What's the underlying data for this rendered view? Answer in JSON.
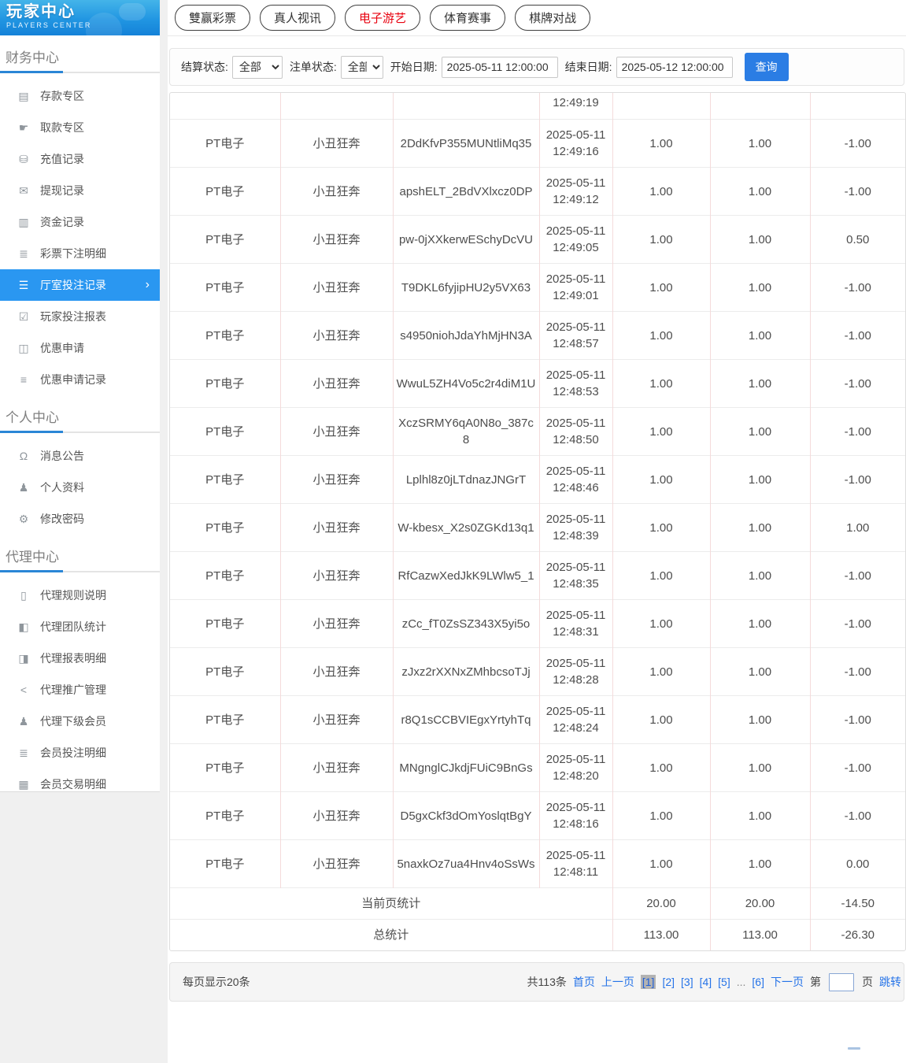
{
  "logo": {
    "title": "玩家中心",
    "subtitle": "PLAYERS CENTER"
  },
  "sidebar": {
    "sections": [
      {
        "title": "财务中心",
        "items": [
          {
            "label": "存款专区",
            "icon": "deposit-card-icon"
          },
          {
            "label": "取款专区",
            "icon": "withdraw-hand-icon"
          },
          {
            "label": "充值记录",
            "icon": "recharge-coins-icon"
          },
          {
            "label": "提现记录",
            "icon": "withdrawal-wallet-icon"
          },
          {
            "label": "资金记录",
            "icon": "funds-banknote-icon"
          },
          {
            "label": "彩票下注明细",
            "icon": "lottery-list-icon"
          },
          {
            "label": "厅室投注记录",
            "icon": "hall-records-icon",
            "active": true
          },
          {
            "label": "玩家投注报表",
            "icon": "player-report-icon"
          },
          {
            "label": "优惠申请",
            "icon": "promo-apply-icon"
          },
          {
            "label": "优惠申请记录",
            "icon": "promo-records-icon"
          }
        ]
      },
      {
        "title": "个人中心",
        "items": [
          {
            "label": "消息公告",
            "icon": "bell-icon"
          },
          {
            "label": "个人资料",
            "icon": "user-icon"
          },
          {
            "label": "修改密码",
            "icon": "gear-icon"
          }
        ]
      },
      {
        "title": "代理中心",
        "items": [
          {
            "label": "代理规则说明",
            "icon": "agent-rules-doc-icon"
          },
          {
            "label": "代理团队统计",
            "icon": "team-stats-icon"
          },
          {
            "label": "代理报表明细",
            "icon": "agent-report-icon"
          },
          {
            "label": "代理推广管理",
            "icon": "share-icon"
          },
          {
            "label": "代理下级会员",
            "icon": "members-icon"
          },
          {
            "label": "会员投注明细",
            "icon": "member-bets-icon"
          },
          {
            "label": "会员交易明细",
            "icon": "member-trades-icon"
          }
        ]
      }
    ]
  },
  "top_tabs": [
    {
      "label": "雙赢彩票",
      "active": false
    },
    {
      "label": "真人视讯",
      "active": false
    },
    {
      "label": "电子游艺",
      "active": true
    },
    {
      "label": "体育赛事",
      "active": false
    },
    {
      "label": "棋牌对战",
      "active": false
    }
  ],
  "filters": {
    "settle_label": "结算状态:",
    "settle_value": "全部",
    "order_label": "注单状态:",
    "order_value": "全部",
    "start_label": "开始日期:",
    "start_value": "2025-05-11 12:00:00",
    "end_label": "结束日期:",
    "end_value": "2025-05-12 12:00:00",
    "search_label": "查询"
  },
  "table": {
    "partial_row_time": "12:49:19",
    "rows": [
      {
        "provider": "PT电子",
        "game": "小丑狂奔",
        "order_id": "2DdKfvP355MUNtliMq35",
        "datetime": "2025-05-11 12:49:16",
        "bet": "1.00",
        "valid": "1.00",
        "profit": "-1.00"
      },
      {
        "provider": "PT电子",
        "game": "小丑狂奔",
        "order_id": "apshELT_2BdVXlxcz0DP",
        "datetime": "2025-05-11 12:49:12",
        "bet": "1.00",
        "valid": "1.00",
        "profit": "-1.00"
      },
      {
        "provider": "PT电子",
        "game": "小丑狂奔",
        "order_id": "pw-0jXXkerwESchyDcVU",
        "datetime": "2025-05-11 12:49:05",
        "bet": "1.00",
        "valid": "1.00",
        "profit": "0.50"
      },
      {
        "provider": "PT电子",
        "game": "小丑狂奔",
        "order_id": "T9DKL6fyjipHU2y5VX63",
        "datetime": "2025-05-11 12:49:01",
        "bet": "1.00",
        "valid": "1.00",
        "profit": "-1.00"
      },
      {
        "provider": "PT电子",
        "game": "小丑狂奔",
        "order_id": "s4950niohJdaYhMjHN3A",
        "datetime": "2025-05-11 12:48:57",
        "bet": "1.00",
        "valid": "1.00",
        "profit": "-1.00"
      },
      {
        "provider": "PT电子",
        "game": "小丑狂奔",
        "order_id": "WwuL5ZH4Vo5c2r4diM1U",
        "datetime": "2025-05-11 12:48:53",
        "bet": "1.00",
        "valid": "1.00",
        "profit": "-1.00"
      },
      {
        "provider": "PT电子",
        "game": "小丑狂奔",
        "order_id": "XczSRMY6qA0N8o_387c8",
        "datetime": "2025-05-11 12:48:50",
        "bet": "1.00",
        "valid": "1.00",
        "profit": "-1.00"
      },
      {
        "provider": "PT电子",
        "game": "小丑狂奔",
        "order_id": "Lplhl8z0jLTdnazJNGrT",
        "datetime": "2025-05-11 12:48:46",
        "bet": "1.00",
        "valid": "1.00",
        "profit": "-1.00"
      },
      {
        "provider": "PT电子",
        "game": "小丑狂奔",
        "order_id": "W-kbesx_X2s0ZGKd13q1",
        "datetime": "2025-05-11 12:48:39",
        "bet": "1.00",
        "valid": "1.00",
        "profit": "1.00"
      },
      {
        "provider": "PT电子",
        "game": "小丑狂奔",
        "order_id": "RfCazwXedJkK9LWlw5_1",
        "datetime": "2025-05-11 12:48:35",
        "bet": "1.00",
        "valid": "1.00",
        "profit": "-1.00"
      },
      {
        "provider": "PT电子",
        "game": "小丑狂奔",
        "order_id": "zCc_fT0ZsSZ343X5yi5o",
        "datetime": "2025-05-11 12:48:31",
        "bet": "1.00",
        "valid": "1.00",
        "profit": "-1.00"
      },
      {
        "provider": "PT电子",
        "game": "小丑狂奔",
        "order_id": "zJxz2rXXNxZMhbcsoTJj",
        "datetime": "2025-05-11 12:48:28",
        "bet": "1.00",
        "valid": "1.00",
        "profit": "-1.00"
      },
      {
        "provider": "PT电子",
        "game": "小丑狂奔",
        "order_id": "r8Q1sCCBVIEgxYrtyhTq",
        "datetime": "2025-05-11 12:48:24",
        "bet": "1.00",
        "valid": "1.00",
        "profit": "-1.00"
      },
      {
        "provider": "PT电子",
        "game": "小丑狂奔",
        "order_id": "MNgnglCJkdjFUiC9BnGs",
        "datetime": "2025-05-11 12:48:20",
        "bet": "1.00",
        "valid": "1.00",
        "profit": "-1.00"
      },
      {
        "provider": "PT电子",
        "game": "小丑狂奔",
        "order_id": "D5gxCkf3dOmYoslqtBgY",
        "datetime": "2025-05-11 12:48:16",
        "bet": "1.00",
        "valid": "1.00",
        "profit": "-1.00"
      },
      {
        "provider": "PT电子",
        "game": "小丑狂奔",
        "order_id": "5naxkOz7ua4Hnv4oSsWs",
        "datetime": "2025-05-11 12:48:11",
        "bet": "1.00",
        "valid": "1.00",
        "profit": "0.00"
      }
    ],
    "page_summary": {
      "label": "当前页统计",
      "bet": "20.00",
      "valid": "20.00",
      "profit": "-14.50"
    },
    "total_summary": {
      "label": "总统计",
      "bet": "113.00",
      "valid": "113.00",
      "profit": "-26.30"
    }
  },
  "pagination": {
    "per_page": "每页显示20条",
    "total": "共113条",
    "first": "首页",
    "prev": "上一页",
    "pages": [
      {
        "label": "[1]",
        "current": true
      },
      {
        "label": "[2]",
        "current": false
      },
      {
        "label": "[3]",
        "current": false
      },
      {
        "label": "[4]",
        "current": false
      },
      {
        "label": "[5]",
        "current": false
      },
      {
        "label": "...",
        "ellipsis": true
      },
      {
        "label": "[6]",
        "current": false
      }
    ],
    "next": "下一页",
    "jump_prefix": "第",
    "jump_value": "",
    "jump_suffix": "页",
    "jump_action": "跳转"
  },
  "colors": {
    "sidebar_active_blue": "#2a97f1",
    "logo_gradient_top": "#44b4e9",
    "logo_gradient_bottom": "#1482d8",
    "section_underline_blue": "#2a86d6",
    "active_tab_red": "#e8000e",
    "search_button_blue": "#2b7de4",
    "link_blue": "#2573e8",
    "current_page_bg": "#b3b3b3",
    "table_vertical_border_pink": "#f4dbdb",
    "table_horizontal_border_gray": "#ececec",
    "page_background": "#f0f0f0"
  }
}
